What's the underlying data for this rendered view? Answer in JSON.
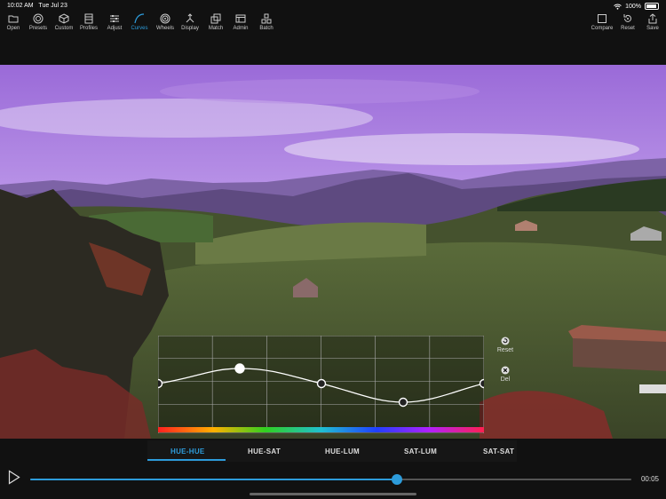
{
  "status": {
    "time": "10:02 AM",
    "date": "Tue Jul 23",
    "battery": "100%"
  },
  "toolbar": {
    "left": [
      {
        "label": "Open",
        "icon": "folder-icon"
      },
      {
        "label": "Presets",
        "icon": "presets-icon"
      },
      {
        "label": "Custom",
        "icon": "cube-icon"
      },
      {
        "label": "Profiles",
        "icon": "profiles-icon"
      },
      {
        "label": "Adjust",
        "icon": "sliders-icon"
      },
      {
        "label": "Curves",
        "icon": "curve-icon"
      },
      {
        "label": "Wheels",
        "icon": "wheels-icon"
      },
      {
        "label": "Display",
        "icon": "display-icon"
      },
      {
        "label": "Match",
        "icon": "match-icon"
      },
      {
        "label": "Admin",
        "icon": "admin-icon"
      },
      {
        "label": "Batch",
        "icon": "batch-icon"
      }
    ],
    "active": "Curves",
    "right": [
      {
        "label": "Compare",
        "icon": "compare-icon"
      },
      {
        "label": "Reset",
        "icon": "reset-icon"
      },
      {
        "label": "Save",
        "icon": "share-icon"
      }
    ]
  },
  "curve_panel": {
    "reset_label": "Reset",
    "delete_label": "Del"
  },
  "curve_tabs": [
    "HUE-HUE",
    "HUE-SAT",
    "HUE-LUM",
    "SAT-LUM",
    "SAT-SAT"
  ],
  "active_tab": "HUE-HUE",
  "playback": {
    "timecode": "00:05",
    "progress": 0.61
  },
  "colors": {
    "accent": "#2d9cdb"
  }
}
